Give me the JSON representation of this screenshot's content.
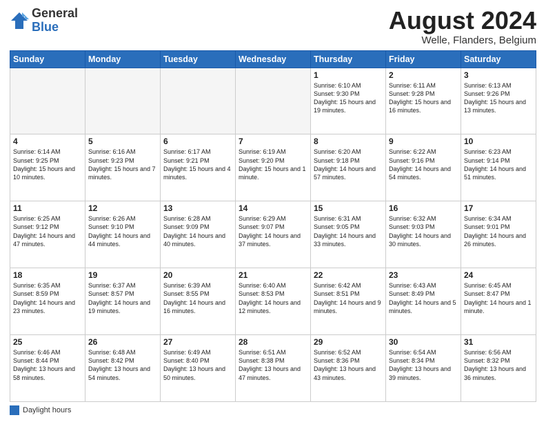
{
  "logo": {
    "general": "General",
    "blue": "Blue"
  },
  "title": "August 2024",
  "location": "Welle, Flanders, Belgium",
  "days_of_week": [
    "Sunday",
    "Monday",
    "Tuesday",
    "Wednesday",
    "Thursday",
    "Friday",
    "Saturday"
  ],
  "legend": {
    "label": "Daylight hours"
  },
  "weeks": [
    [
      {
        "day": "",
        "sunrise": "",
        "sunset": "",
        "daylight": "",
        "empty": true
      },
      {
        "day": "",
        "sunrise": "",
        "sunset": "",
        "daylight": "",
        "empty": true
      },
      {
        "day": "",
        "sunrise": "",
        "sunset": "",
        "daylight": "",
        "empty": true
      },
      {
        "day": "",
        "sunrise": "",
        "sunset": "",
        "daylight": "",
        "empty": true
      },
      {
        "day": "1",
        "sunrise": "Sunrise: 6:10 AM",
        "sunset": "Sunset: 9:30 PM",
        "daylight": "Daylight: 15 hours and 19 minutes.",
        "empty": false
      },
      {
        "day": "2",
        "sunrise": "Sunrise: 6:11 AM",
        "sunset": "Sunset: 9:28 PM",
        "daylight": "Daylight: 15 hours and 16 minutes.",
        "empty": false
      },
      {
        "day": "3",
        "sunrise": "Sunrise: 6:13 AM",
        "sunset": "Sunset: 9:26 PM",
        "daylight": "Daylight: 15 hours and 13 minutes.",
        "empty": false
      }
    ],
    [
      {
        "day": "4",
        "sunrise": "Sunrise: 6:14 AM",
        "sunset": "Sunset: 9:25 PM",
        "daylight": "Daylight: 15 hours and 10 minutes.",
        "empty": false
      },
      {
        "day": "5",
        "sunrise": "Sunrise: 6:16 AM",
        "sunset": "Sunset: 9:23 PM",
        "daylight": "Daylight: 15 hours and 7 minutes.",
        "empty": false
      },
      {
        "day": "6",
        "sunrise": "Sunrise: 6:17 AM",
        "sunset": "Sunset: 9:21 PM",
        "daylight": "Daylight: 15 hours and 4 minutes.",
        "empty": false
      },
      {
        "day": "7",
        "sunrise": "Sunrise: 6:19 AM",
        "sunset": "Sunset: 9:20 PM",
        "daylight": "Daylight: 15 hours and 1 minute.",
        "empty": false
      },
      {
        "day": "8",
        "sunrise": "Sunrise: 6:20 AM",
        "sunset": "Sunset: 9:18 PM",
        "daylight": "Daylight: 14 hours and 57 minutes.",
        "empty": false
      },
      {
        "day": "9",
        "sunrise": "Sunrise: 6:22 AM",
        "sunset": "Sunset: 9:16 PM",
        "daylight": "Daylight: 14 hours and 54 minutes.",
        "empty": false
      },
      {
        "day": "10",
        "sunrise": "Sunrise: 6:23 AM",
        "sunset": "Sunset: 9:14 PM",
        "daylight": "Daylight: 14 hours and 51 minutes.",
        "empty": false
      }
    ],
    [
      {
        "day": "11",
        "sunrise": "Sunrise: 6:25 AM",
        "sunset": "Sunset: 9:12 PM",
        "daylight": "Daylight: 14 hours and 47 minutes.",
        "empty": false
      },
      {
        "day": "12",
        "sunrise": "Sunrise: 6:26 AM",
        "sunset": "Sunset: 9:10 PM",
        "daylight": "Daylight: 14 hours and 44 minutes.",
        "empty": false
      },
      {
        "day": "13",
        "sunrise": "Sunrise: 6:28 AM",
        "sunset": "Sunset: 9:09 PM",
        "daylight": "Daylight: 14 hours and 40 minutes.",
        "empty": false
      },
      {
        "day": "14",
        "sunrise": "Sunrise: 6:29 AM",
        "sunset": "Sunset: 9:07 PM",
        "daylight": "Daylight: 14 hours and 37 minutes.",
        "empty": false
      },
      {
        "day": "15",
        "sunrise": "Sunrise: 6:31 AM",
        "sunset": "Sunset: 9:05 PM",
        "daylight": "Daylight: 14 hours and 33 minutes.",
        "empty": false
      },
      {
        "day": "16",
        "sunrise": "Sunrise: 6:32 AM",
        "sunset": "Sunset: 9:03 PM",
        "daylight": "Daylight: 14 hours and 30 minutes.",
        "empty": false
      },
      {
        "day": "17",
        "sunrise": "Sunrise: 6:34 AM",
        "sunset": "Sunset: 9:01 PM",
        "daylight": "Daylight: 14 hours and 26 minutes.",
        "empty": false
      }
    ],
    [
      {
        "day": "18",
        "sunrise": "Sunrise: 6:35 AM",
        "sunset": "Sunset: 8:59 PM",
        "daylight": "Daylight: 14 hours and 23 minutes.",
        "empty": false
      },
      {
        "day": "19",
        "sunrise": "Sunrise: 6:37 AM",
        "sunset": "Sunset: 8:57 PM",
        "daylight": "Daylight: 14 hours and 19 minutes.",
        "empty": false
      },
      {
        "day": "20",
        "sunrise": "Sunrise: 6:39 AM",
        "sunset": "Sunset: 8:55 PM",
        "daylight": "Daylight: 14 hours and 16 minutes.",
        "empty": false
      },
      {
        "day": "21",
        "sunrise": "Sunrise: 6:40 AM",
        "sunset": "Sunset: 8:53 PM",
        "daylight": "Daylight: 14 hours and 12 minutes.",
        "empty": false
      },
      {
        "day": "22",
        "sunrise": "Sunrise: 6:42 AM",
        "sunset": "Sunset: 8:51 PM",
        "daylight": "Daylight: 14 hours and 9 minutes.",
        "empty": false
      },
      {
        "day": "23",
        "sunrise": "Sunrise: 6:43 AM",
        "sunset": "Sunset: 8:49 PM",
        "daylight": "Daylight: 14 hours and 5 minutes.",
        "empty": false
      },
      {
        "day": "24",
        "sunrise": "Sunrise: 6:45 AM",
        "sunset": "Sunset: 8:47 PM",
        "daylight": "Daylight: 14 hours and 1 minute.",
        "empty": false
      }
    ],
    [
      {
        "day": "25",
        "sunrise": "Sunrise: 6:46 AM",
        "sunset": "Sunset: 8:44 PM",
        "daylight": "Daylight: 13 hours and 58 minutes.",
        "empty": false
      },
      {
        "day": "26",
        "sunrise": "Sunrise: 6:48 AM",
        "sunset": "Sunset: 8:42 PM",
        "daylight": "Daylight: 13 hours and 54 minutes.",
        "empty": false
      },
      {
        "day": "27",
        "sunrise": "Sunrise: 6:49 AM",
        "sunset": "Sunset: 8:40 PM",
        "daylight": "Daylight: 13 hours and 50 minutes.",
        "empty": false
      },
      {
        "day": "28",
        "sunrise": "Sunrise: 6:51 AM",
        "sunset": "Sunset: 8:38 PM",
        "daylight": "Daylight: 13 hours and 47 minutes.",
        "empty": false
      },
      {
        "day": "29",
        "sunrise": "Sunrise: 6:52 AM",
        "sunset": "Sunset: 8:36 PM",
        "daylight": "Daylight: 13 hours and 43 minutes.",
        "empty": false
      },
      {
        "day": "30",
        "sunrise": "Sunrise: 6:54 AM",
        "sunset": "Sunset: 8:34 PM",
        "daylight": "Daylight: 13 hours and 39 minutes.",
        "empty": false
      },
      {
        "day": "31",
        "sunrise": "Sunrise: 6:56 AM",
        "sunset": "Sunset: 8:32 PM",
        "daylight": "Daylight: 13 hours and 36 minutes.",
        "empty": false
      }
    ]
  ]
}
